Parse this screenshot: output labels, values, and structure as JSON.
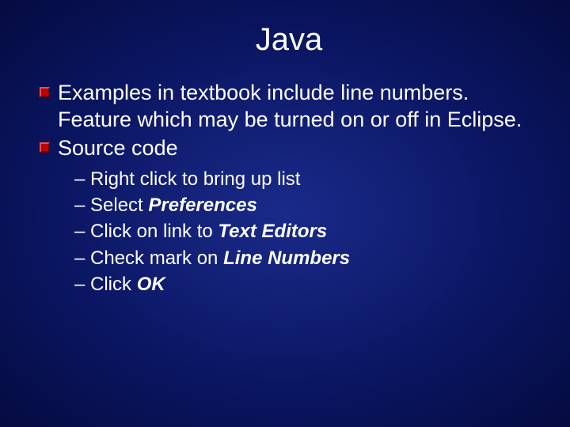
{
  "title": "Java",
  "bullets": [
    "Examples in textbook include line numbers.  Feature which may be turned on or off in Eclipse.",
    "Source code"
  ],
  "subitems": [
    {
      "prefix": "– Right click to bring up list",
      "bold": ""
    },
    {
      "prefix": "– Select ",
      "bold": "Preferences"
    },
    {
      "prefix": "– Click on link to ",
      "bold": "Text Editors"
    },
    {
      "prefix": "– Check mark on ",
      "bold": "Line Numbers"
    },
    {
      "prefix": "– Click ",
      "bold": "OK"
    }
  ]
}
